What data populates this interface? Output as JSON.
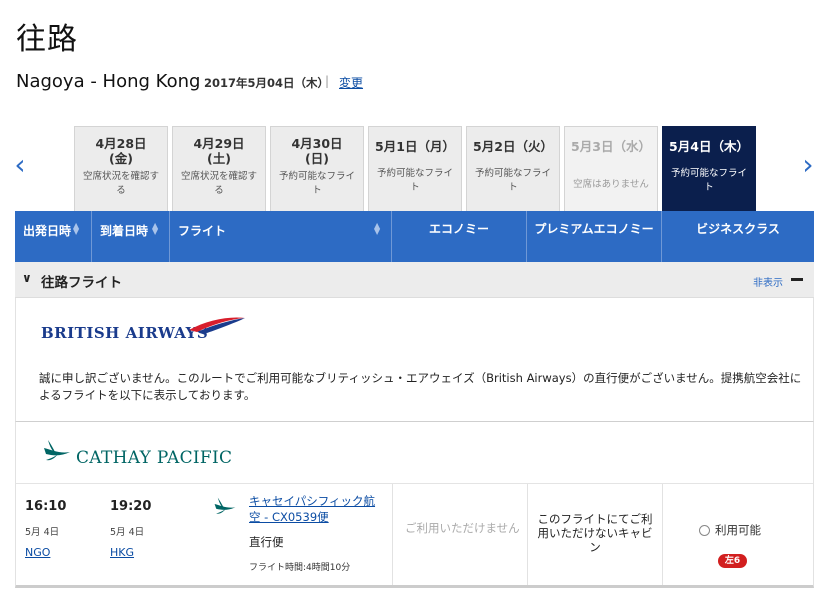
{
  "page": {
    "title": "往路",
    "route": "Nagoya - Hong Kong",
    "date": "2017年5月04日（木）",
    "separator": "|",
    "change_link": "変更"
  },
  "nav": {
    "prev": "‹",
    "next": "›"
  },
  "date_tabs": [
    {
      "line1": "4月28日",
      "line2": "(金)",
      "sub": "空席状況を確認する",
      "state": "normal"
    },
    {
      "line1": "4月29日",
      "line2": "(土)",
      "sub": "空席状況を確認する",
      "state": "normal"
    },
    {
      "line1": "4月30日",
      "line2": "(日)",
      "sub": "予約可能なフライト",
      "state": "normal"
    },
    {
      "line1": "5月1日（月）",
      "line2": "",
      "sub": "予約可能なフライト",
      "state": "normal"
    },
    {
      "line1": "5月2日（火）",
      "line2": "",
      "sub": "予約可能なフライト",
      "state": "normal"
    },
    {
      "line1": "5月3日（水）",
      "line2": "",
      "sub": "空席はありません",
      "state": "disabled"
    },
    {
      "line1": "5月4日（木）",
      "line2": "",
      "sub": "予約可能なフライト",
      "state": "active"
    }
  ],
  "grid_header": {
    "depart": "出発日時",
    "arrive": "到着日時",
    "flight": "フライト",
    "economy": "エコノミー",
    "premium": "プレミアムエコノミー",
    "business": "ビジネスクラス"
  },
  "section": {
    "chevron": "∨",
    "title": "往路フライト",
    "hide": "非表示"
  },
  "british_airways": {
    "logo_text": "BRITISH AIRWAYS",
    "message": "誠に申し訳ございません。このルートでご利用可能なブリティッシュ・エアウェイズ（British Airways）の直行便がございません。提携航空会社によるフライトを以下に表示しております。"
  },
  "cathay": {
    "logo_text": "CATHAY PACIFIC"
  },
  "flight": {
    "depart_time": "16:10",
    "depart_date": "5月 4日",
    "depart_code": "NGO",
    "arrive_time": "19:20",
    "arrive_date": "5月 4日",
    "arrive_code": "HKG",
    "airline": "キャセイパシフィック航空 - CX0539便",
    "direct": "直行便",
    "duration": "フライト時間:4時間10分",
    "economy": "ご利用いただけません",
    "premium": "このフライトにてご利用いただけないキャビン",
    "business_label": "利用可能",
    "seats_left": "左6"
  },
  "colors": {
    "header_blue": "#2d6bc4",
    "active_tab": "#0b1f4d",
    "link_blue": "#0b4ca3",
    "badge_red": "#d21f1f",
    "cathay_green": "#006564"
  }
}
